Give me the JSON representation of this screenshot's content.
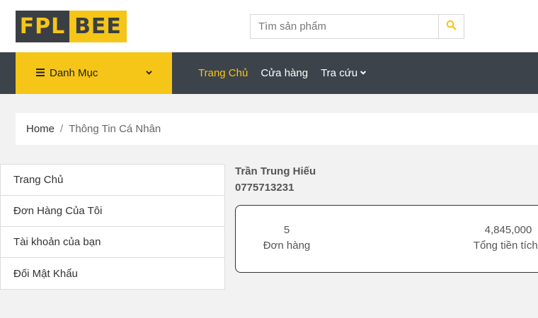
{
  "header": {
    "logo_left": "FPL",
    "logo_right": "BEE",
    "search_placeholder": "Tìm sản phẩm",
    "search_value": "",
    "search_icon": "search-icon",
    "accent_color": "#f5c518",
    "dark_color": "#3d434a"
  },
  "nav": {
    "category_label": "Danh Mục",
    "links": [
      {
        "label": "Trang Chủ",
        "active": true
      },
      {
        "label": "Cửa hàng",
        "active": false
      },
      {
        "label": "Tra cứu",
        "active": false,
        "dropdown": true
      }
    ]
  },
  "breadcrumb": {
    "home": "Home",
    "separator": "/",
    "current": "Thông Tin Cá Nhân"
  },
  "sidebar": {
    "items": [
      {
        "label": "Trang Chủ"
      },
      {
        "label": "Đơn Hàng Của Tôi"
      },
      {
        "label": "Tài khoản của bạn"
      },
      {
        "label": "Đối Mật Khẩu"
      }
    ]
  },
  "profile": {
    "name": "Trần Trung Hiếu",
    "phone": "0775713231",
    "stats": [
      {
        "value": "5",
        "label": "Đơn hàng"
      },
      {
        "value": "4,845,000",
        "label": "Tổng tiền tích l"
      }
    ]
  }
}
